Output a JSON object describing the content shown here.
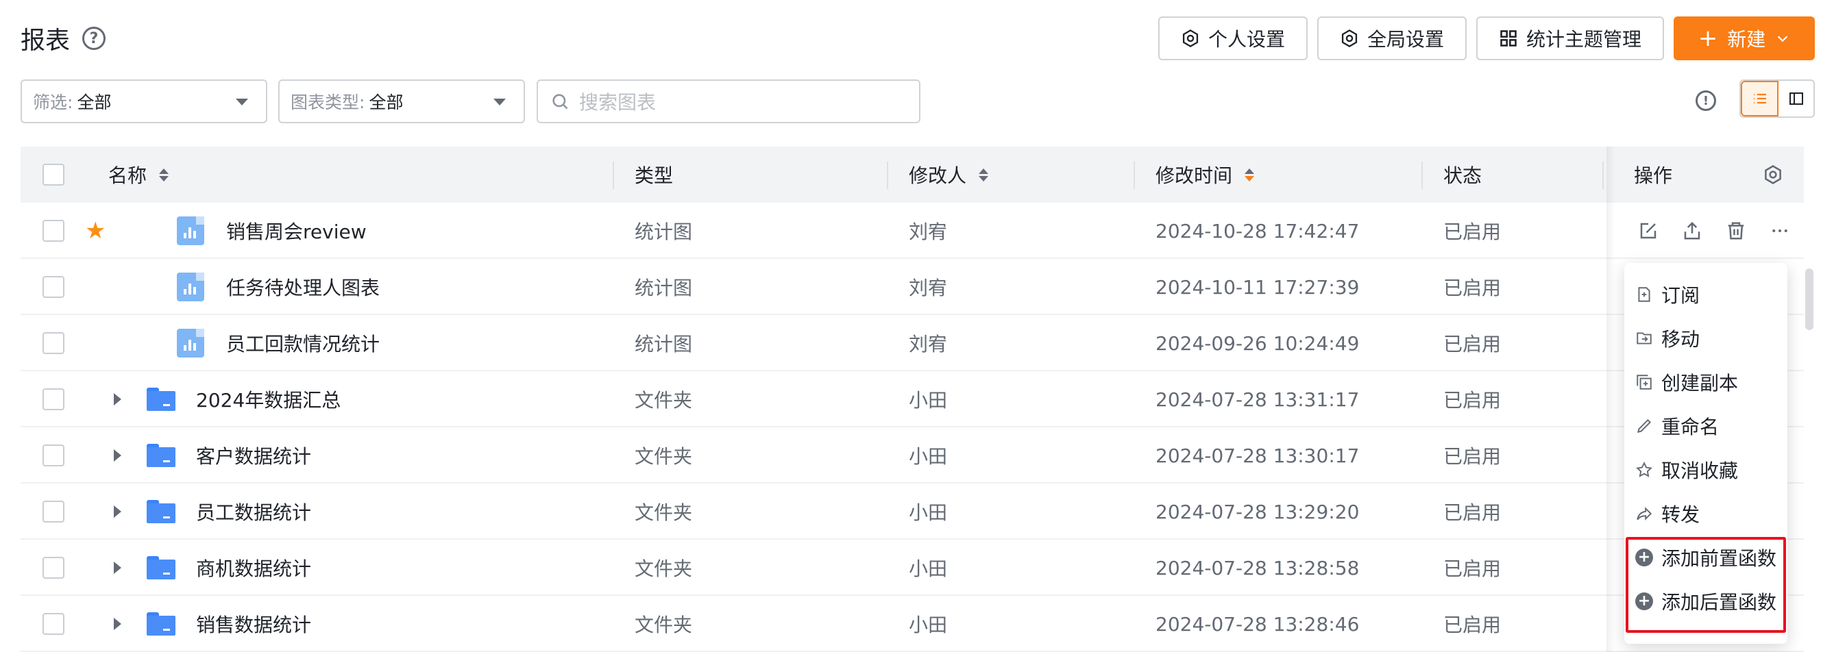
{
  "header": {
    "title": "报表",
    "personal_settings": "个人设置",
    "global_settings": "全局设置",
    "topic_management": "统计主题管理",
    "new_button": "新建"
  },
  "filters": {
    "filter_label": "筛选:",
    "filter_value": "全部",
    "chart_type_label": "图表类型:",
    "chart_type_value": "全部",
    "search_placeholder": "搜索图表"
  },
  "columns": {
    "name": "名称",
    "type": "类型",
    "modifier": "修改人",
    "modified_time": "修改时间",
    "status": "状态",
    "actions": "操作"
  },
  "rows": [
    {
      "name": "销售周会review",
      "type": "统计图",
      "modifier": "刘宥",
      "time": "2024-10-28 17:42:47",
      "status": "已启用"
    },
    {
      "name": "任务待处理人图表",
      "type": "统计图",
      "modifier": "刘宥",
      "time": "2024-10-11 17:27:39",
      "status": "已启用"
    },
    {
      "name": "员工回款情况统计",
      "type": "统计图",
      "modifier": "刘宥",
      "time": "2024-09-26 10:24:49",
      "status": "已启用"
    },
    {
      "name": "2024年数据汇总",
      "type": "文件夹",
      "modifier": "小田",
      "time": "2024-07-28 13:31:17",
      "status": "已启用"
    },
    {
      "name": "客户数据统计",
      "type": "文件夹",
      "modifier": "小田",
      "time": "2024-07-28 13:30:17",
      "status": "已启用"
    },
    {
      "name": "员工数据统计",
      "type": "文件夹",
      "modifier": "小田",
      "time": "2024-07-28 13:29:20",
      "status": "已启用"
    },
    {
      "name": "商机数据统计",
      "type": "文件夹",
      "modifier": "小田",
      "time": "2024-07-28 13:28:58",
      "status": "已启用"
    },
    {
      "name": "销售数据统计",
      "type": "文件夹",
      "modifier": "小田",
      "time": "2024-07-28 13:28:46",
      "status": "已启用"
    }
  ],
  "menu": {
    "subscribe": "订阅",
    "move": "移动",
    "duplicate": "创建副本",
    "rename": "重命名",
    "unfavorite": "取消收藏",
    "forward": "转发",
    "add_pre_function": "添加前置函数",
    "add_post_function": "添加后置函数"
  },
  "colors": {
    "accent": "#fa7d15",
    "highlight": "#e8131f"
  }
}
